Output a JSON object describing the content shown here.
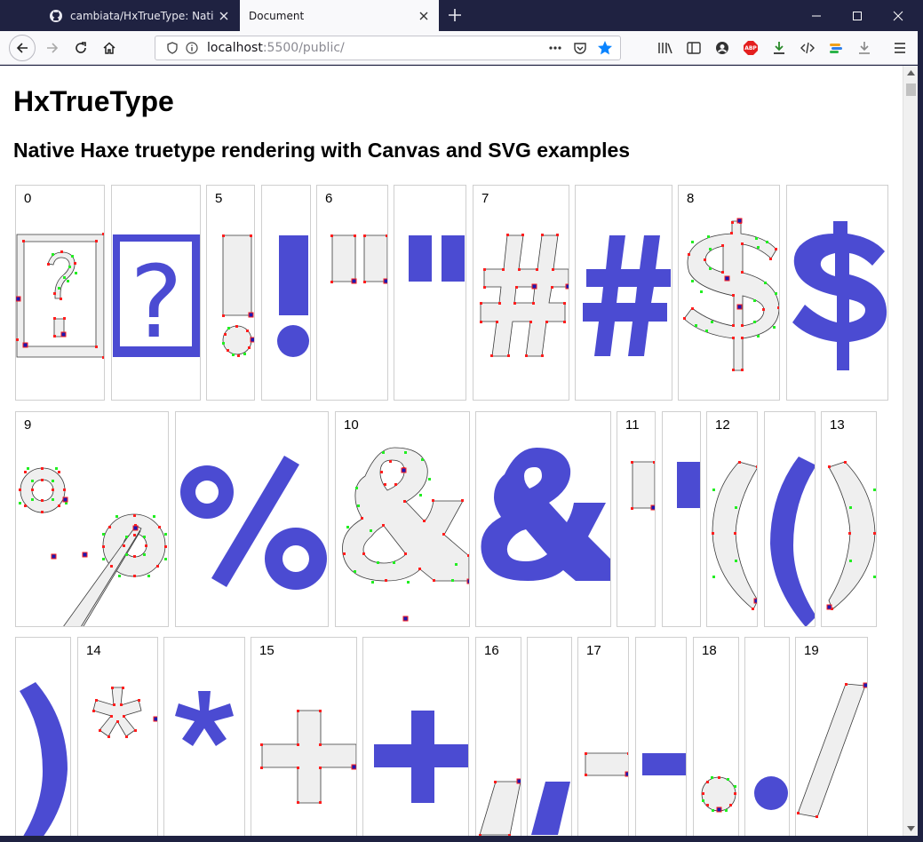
{
  "browser": {
    "tabs": [
      {
        "title": "cambiata/HxTrueType: Native H",
        "active": false,
        "icon": "github-icon"
      },
      {
        "title": "Document",
        "active": true
      }
    ],
    "url": {
      "host": "localhost",
      "rest": ":5500/public/"
    },
    "toolbar_icons": [
      "library-icon",
      "sidebar-icon",
      "account-icon",
      "adblock-plus-icon",
      "download-icon",
      "devtools-icon",
      "extension-icon",
      "downloads-icon",
      "menu-icon"
    ],
    "adblock_label": "ABP"
  },
  "page": {
    "title": "HxTrueType",
    "subtitle": "Native Haxe truetype rendering with Canvas and SVG examples"
  },
  "glyph_labels": [
    "0",
    "5",
    "6",
    "7",
    "8",
    "9",
    "10",
    "11",
    "12",
    "13",
    "14",
    "15",
    "16",
    "17",
    "18",
    "19"
  ],
  "glyphs": {
    "notdef": "?",
    "exclam": "!",
    "quotedbl": "\"",
    "numbersign": "#",
    "dollar": "$",
    "percent": "%",
    "ampersand": "&",
    "quotesingle": "'",
    "parenleft": "(",
    "parenright": ")",
    "asterisk": "*",
    "plus": "+",
    "comma": ",",
    "hyphen": "-",
    "period": ".",
    "slash": "/"
  },
  "colors": {
    "glyph_fill": "#4b4bd2",
    "on_curve_point": "#ff1e1e",
    "off_curve_point": "#22ee22",
    "start_point": "#1a1ab4",
    "outline_fill": "#efefef"
  }
}
